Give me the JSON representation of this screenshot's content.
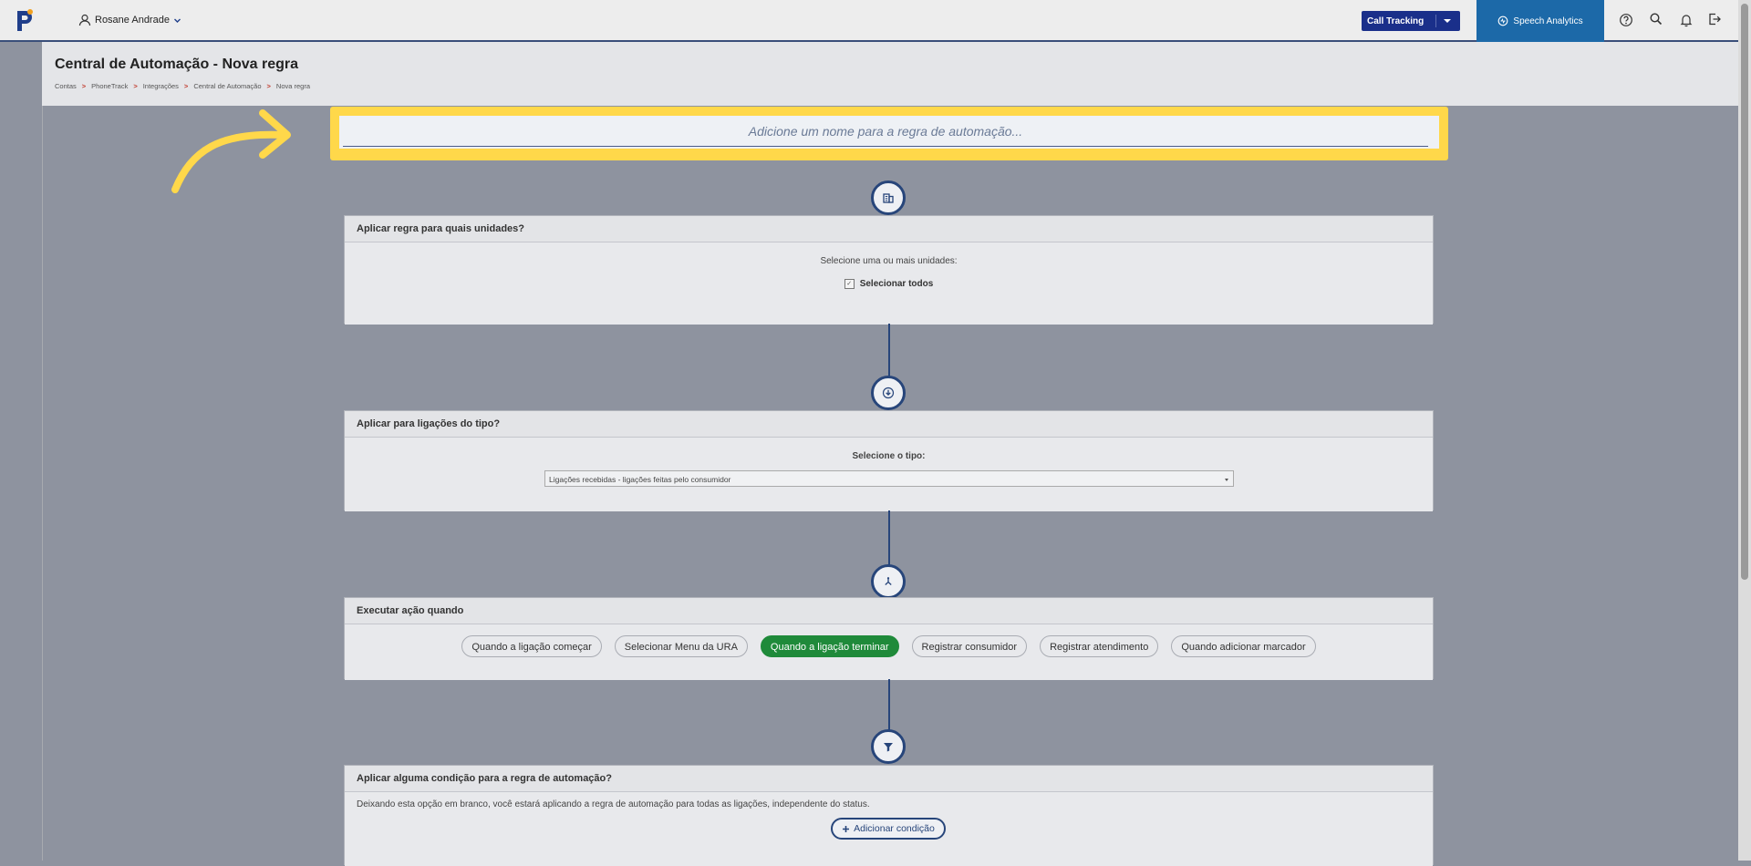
{
  "topbar": {
    "user_name": "Rosane Andrade",
    "call_tracking_label": "Call Tracking",
    "speech_analytics_label": "Speech Analytics",
    "icons": [
      "help-icon",
      "search-icon",
      "bell-icon",
      "logout-icon"
    ]
  },
  "header": {
    "title": "Central de Automação - Nova regra",
    "breadcrumb": [
      "Contas",
      "PhoneTrack",
      "Integrações",
      "Central de Automação",
      "Nova regra"
    ]
  },
  "name_input": {
    "placeholder": "Adicione um nome para a regra de automação..."
  },
  "units_card": {
    "title": "Aplicar regra para quais unidades?",
    "prompt": "Selecione uma ou mais unidades:",
    "select_all_label": "Selecionar todos",
    "select_all_checked": true
  },
  "call_type_card": {
    "title": "Aplicar para ligações do tipo?",
    "prompt": "Selecione o tipo:",
    "selected": "Ligações recebidas - ligações feitas pelo consumidor"
  },
  "action_card": {
    "title": "Executar ação quando",
    "options": [
      "Quando a ligação começar",
      "Selecionar Menu da URA",
      "Quando a ligação terminar",
      "Registrar consumidor",
      "Registrar atendimento",
      "Quando adicionar marcador"
    ],
    "active_option": "Quando a ligação terminar"
  },
  "condition_card": {
    "title": "Aplicar alguma condição para a regra de automação?",
    "description": "Deixando esta opção em branco, você estará aplicando a regra de automação para todas as ligações, independente do status.",
    "add_button_label": "Adicionar condição"
  },
  "colors": {
    "highlight": "#ffd84a",
    "primary": "#27457a",
    "active_pill": "#1f8a3a",
    "speech_analytics_bg": "#1c69a8",
    "call_tracking_bg": "#1a2f8a"
  }
}
